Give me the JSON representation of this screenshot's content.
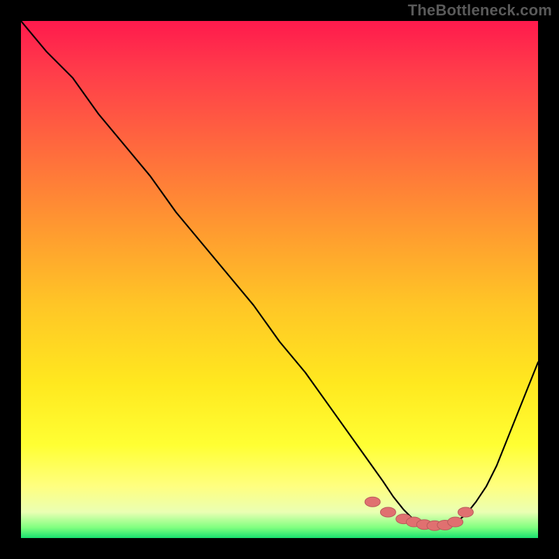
{
  "watermark": "TheBottleneck.com",
  "colors": {
    "frame": "#000000",
    "curve": "#000000",
    "marker_fill": "#e07070",
    "marker_stroke": "#b85a5a"
  },
  "chart_data": {
    "type": "line",
    "title": "",
    "xlabel": "",
    "ylabel": "",
    "xlim": [
      0,
      100
    ],
    "ylim": [
      0,
      100
    ],
    "grid": false,
    "legend": false,
    "series": [
      {
        "name": "bottleneck-curve",
        "x": [
          0,
          5,
          10,
          15,
          20,
          25,
          30,
          35,
          40,
          45,
          50,
          55,
          60,
          65,
          70,
          72,
          74,
          76,
          78,
          80,
          82,
          84,
          86,
          88,
          90,
          92,
          94,
          96,
          98,
          100
        ],
        "values": [
          100,
          94,
          89,
          82,
          76,
          70,
          63,
          57,
          51,
          45,
          38,
          32,
          25,
          18,
          11,
          8,
          5.5,
          3.5,
          2.5,
          2.2,
          2.2,
          3,
          4.5,
          7,
          10,
          14,
          19,
          24,
          29,
          34
        ]
      }
    ],
    "markers": {
      "name": "bottom-cluster",
      "x": [
        68,
        71,
        74,
        76,
        78,
        80,
        82,
        84,
        86
      ],
      "values": [
        7,
        5,
        3.7,
        3.1,
        2.6,
        2.4,
        2.5,
        3.1,
        5
      ]
    }
  }
}
